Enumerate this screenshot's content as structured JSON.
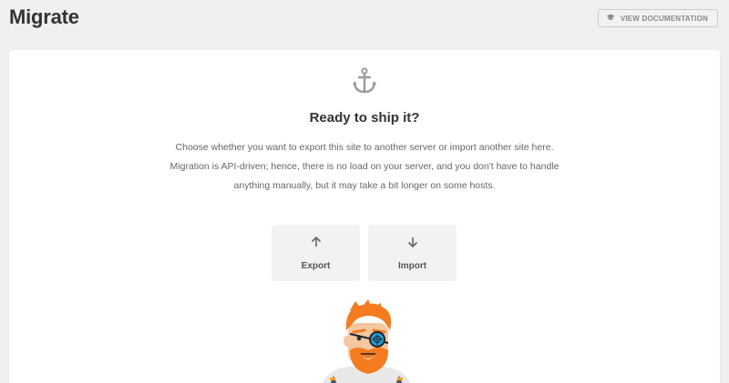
{
  "header": {
    "title": "Migrate",
    "doc_button_label": "VIEW DOCUMENTATION",
    "doc_icon": "graduation-cap-icon"
  },
  "card": {
    "icon": "anchor-icon",
    "heading": "Ready to ship it?",
    "description_lines": [
      "Choose whether you want to export this site to another server or import another site here.",
      "Migration is API-driven; hence, there is no load on your server, and you don't have to handle",
      "anything manually, but it may take a bit longer on some hosts."
    ],
    "actions": [
      {
        "label": "Export",
        "icon": "arrow-up-icon"
      },
      {
        "label": "Import",
        "icon": "arrow-down-icon"
      }
    ],
    "mascot": "pirate-mascot"
  },
  "colors": {
    "background": "#f0f0f0",
    "card": "#ffffff",
    "action_bg": "#f2f2f2",
    "mascot_orange": "#f47b20",
    "monocle_blue": "#1aa0d8"
  }
}
